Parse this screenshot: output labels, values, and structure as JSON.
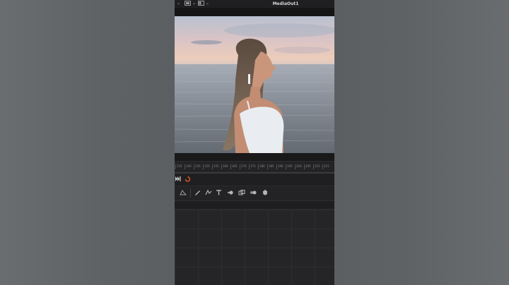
{
  "window": {
    "title": "MediaOut1"
  },
  "ruler": {
    "ticks": [
      "135",
      "140",
      "145",
      "150",
      "155",
      "160",
      "165",
      "170",
      "175",
      "180",
      "185",
      "190",
      "195",
      "200",
      "205",
      "210",
      "215"
    ]
  },
  "icons": {
    "chevron": "chevron-down-icon",
    "view_a": "viewer-layout-icon",
    "view_b": "viewer-options-icon",
    "skip_end": "skip-to-end-icon",
    "loop": "loop-icon"
  },
  "colors": {
    "accent_loop": "#e8531f",
    "panel": "#1c1c1e",
    "background": "#5f6265"
  }
}
